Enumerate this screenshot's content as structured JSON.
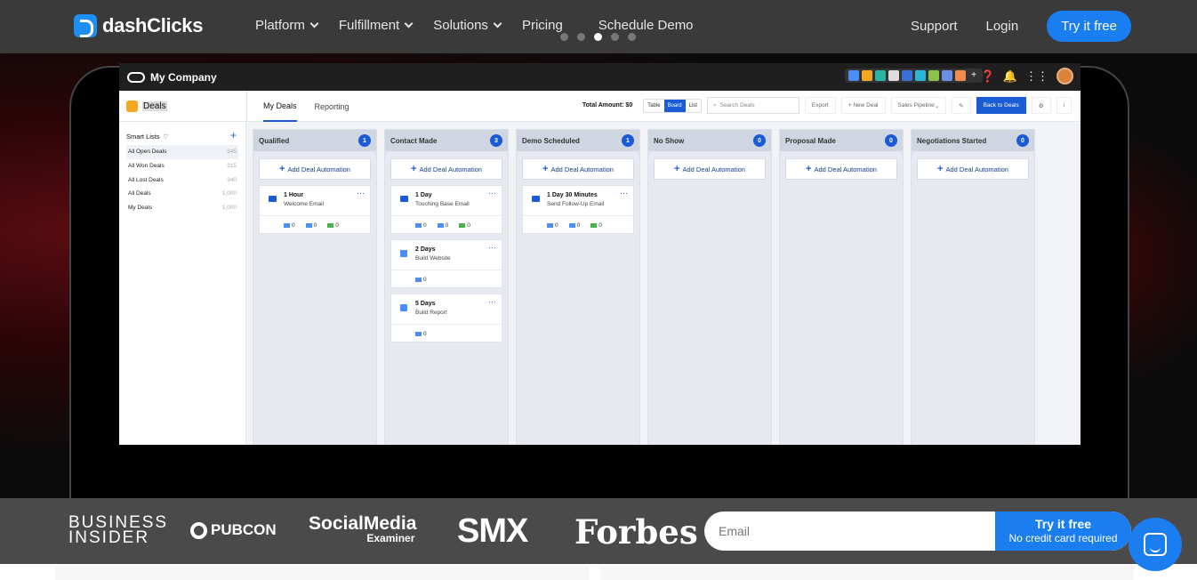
{
  "nav": {
    "brand": "dashClicks",
    "links": [
      {
        "label": "Platform",
        "dropdown": true
      },
      {
        "label": "Fulfillment",
        "dropdown": true
      },
      {
        "label": "Solutions",
        "dropdown": true
      },
      {
        "label": "Pricing",
        "dropdown": false
      },
      {
        "label": "Schedule Demo",
        "dropdown": false
      }
    ],
    "support": "Support",
    "login": "Login",
    "try": "Try it free"
  },
  "carousel": {
    "count": 5,
    "active": 3
  },
  "app": {
    "company": "My Company",
    "module": "Deals",
    "tabs": [
      "My Deals",
      "Reporting"
    ],
    "total_amount": "Total Amount: $0",
    "views": [
      "Table",
      "Board",
      "List"
    ],
    "active_view": "Board",
    "search_placeholder": "Search Deals",
    "export": "Export",
    "new_deal": "+ New Deal",
    "pipeline": "Sales Pipeline",
    "back": "Back to Deals",
    "smart_lists_title": "Smart Lists",
    "smart_lists": [
      {
        "label": "All Open Deals",
        "count": "345"
      },
      {
        "label": "All Won Deals",
        "count": "315"
      },
      {
        "label": "All Lost Deals",
        "count": "340"
      },
      {
        "label": "All Deals",
        "count": "1,000"
      },
      {
        "label": "My Deals",
        "count": "1,000"
      }
    ],
    "add_automation": "Add Deal Automation",
    "columns": [
      {
        "name": "Qualified",
        "count": "1",
        "cards": [
          {
            "time": "1 Hour",
            "title": "Welcome Email",
            "stats": [
              "0",
              "0",
              "0"
            ]
          }
        ]
      },
      {
        "name": "Contact Made",
        "count": "3",
        "cards": [
          {
            "time": "1 Day",
            "title": "Touching Base Email",
            "stats": [
              "0",
              "0",
              "0"
            ]
          },
          {
            "time": "2 Days",
            "title": "Build Website",
            "stats": [
              "0"
            ]
          },
          {
            "time": "5 Days",
            "title": "Build Report",
            "stats": [
              "0"
            ]
          }
        ]
      },
      {
        "name": "Demo Scheduled",
        "count": "1",
        "cards": [
          {
            "time": "1 Day 30 Minutes",
            "title": "Send Follow-Up Email",
            "stats": [
              "0",
              "0",
              "0"
            ]
          }
        ]
      },
      {
        "name": "No Show",
        "count": "0",
        "cards": []
      },
      {
        "name": "Proposal Made",
        "count": "0",
        "cards": []
      },
      {
        "name": "Negotiations Started",
        "count": "0",
        "cards": []
      }
    ]
  },
  "press": {
    "business_insider": [
      "BUSINESS",
      "INSIDER"
    ],
    "pubcon": "PUBCON",
    "sme": [
      "SocialMedia",
      "Examiner"
    ],
    "smx": "SMX",
    "forbes": "Forbes"
  },
  "signup": {
    "placeholder": "Email",
    "button_main": "Try it free",
    "button_sub": "No credit card required"
  }
}
